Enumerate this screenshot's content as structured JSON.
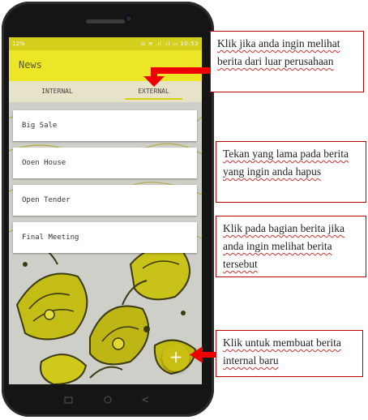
{
  "status_bar": {
    "left": "12%",
    "right": "⊙ ≋ .ıl .ıl ▭ 10:53"
  },
  "app_bar": {
    "title": "News"
  },
  "tabs": [
    {
      "label": "INTERNAL"
    },
    {
      "label": "EXTERNAL"
    }
  ],
  "news_items": [
    {
      "title": "Big Sale"
    },
    {
      "title": "Ooen House"
    },
    {
      "title": "Open Tender"
    },
    {
      "title": "Final Meeting"
    }
  ],
  "fab": {
    "label": "+"
  },
  "callouts": [
    {
      "text": "Klik jika anda ingin melihat berita dari luar perusahaan"
    },
    {
      "text": "Tekan yang lama pada berita yang ingin anda hapus"
    },
    {
      "text": "Klik pada bagian berita jika anda ingin melihat berita tersebut"
    },
    {
      "text": "Klik untuk membuat berita internal baru"
    }
  ],
  "colors": {
    "status_bar": "#d4cf1b",
    "app_bar": "#ece627",
    "fab": "#c9bf12",
    "arrow": "#ee0000",
    "callout_border": "#c00000"
  }
}
